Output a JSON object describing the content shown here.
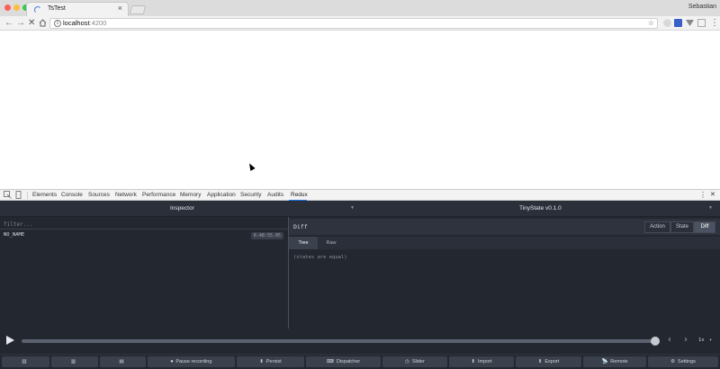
{
  "colors": {
    "chrome_bg": "#dcdcdc",
    "toolbar_bg": "#f2f2f2",
    "redux_bg": "#2a2f3a",
    "redux_panel": "#232730",
    "accent_blue": "#1a73e8"
  },
  "browser": {
    "tab_title": "TsTest",
    "tab_close": "×",
    "profile_name": "Sebastian",
    "url_host": "localhost",
    "url_port": ":4200",
    "info_glyph": "i",
    "star_glyph": "☆",
    "icons": [
      "back-icon",
      "forward-icon",
      "reload-icon",
      "home-icon",
      "info-icon",
      "star-icon",
      "extension-icons",
      "menu-icon"
    ]
  },
  "devtools": {
    "tabs": [
      "Elements",
      "Console",
      "Sources",
      "Network",
      "Performance",
      "Memory",
      "Application",
      "Security",
      "Audits",
      "Redux"
    ],
    "active_tab": "Redux",
    "more_glyph": "⋮",
    "close_glyph": "✕"
  },
  "redux": {
    "left_title": "Inspector",
    "right_title": "TinyState v0.1.0",
    "filter_placeholder": "filter...",
    "actions": [
      {
        "name": "NO_NAME",
        "time": "6:48:55.05"
      }
    ],
    "diff_label": "Diff",
    "modes": [
      "Action",
      "State",
      "Diff"
    ],
    "active_mode": "Diff",
    "subtabs": [
      "Tree",
      "Raw"
    ],
    "active_subtab": "Tree",
    "diff_message": "(states are equal)",
    "speed": "1x",
    "slider_progress": 1.0,
    "bottom_buttons": [
      {
        "label": "",
        "icon": "▥"
      },
      {
        "label": "",
        "icon": "▥"
      },
      {
        "label": "",
        "icon": "▤"
      },
      {
        "label": "Pause recording",
        "icon": "⏺"
      },
      {
        "label": "Persist",
        "icon": "⬍"
      },
      {
        "label": "Dispatcher",
        "icon": "⌨"
      },
      {
        "label": "Slider",
        "icon": "◷"
      },
      {
        "label": "Import",
        "icon": "⬆"
      },
      {
        "label": "Export",
        "icon": "⬆"
      },
      {
        "label": "Remote",
        "icon": "📡"
      },
      {
        "label": "Settings",
        "icon": "⚙"
      }
    ]
  }
}
